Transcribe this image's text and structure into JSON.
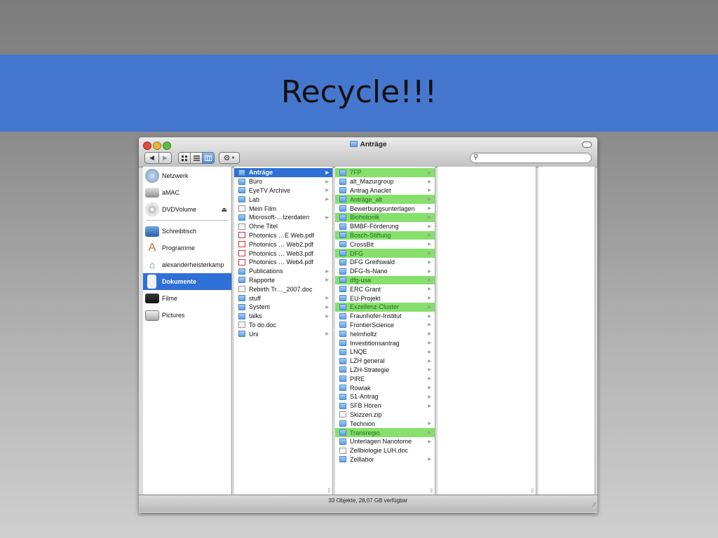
{
  "slide": {
    "title": "Recycle!!!"
  },
  "window": {
    "title": "Anträge",
    "status": "33 Objekte, 28,07 GB verfügbar",
    "toolbar": {
      "back": "◀",
      "forward": "▶",
      "search_placeholder": ""
    }
  },
  "sidebar": {
    "items": [
      {
        "label": "Netzwerk",
        "icon": "network-globe-icon"
      },
      {
        "label": "aMAC",
        "icon": "hard-drive-icon"
      },
      {
        "label": "DVDVolume",
        "icon": "dvd-icon"
      },
      {
        "label": "Schreibtisch",
        "icon": "desktop-icon"
      },
      {
        "label": "Programme",
        "icon": "applications-icon"
      },
      {
        "label": "alexanderheisterkamp",
        "icon": "home-icon"
      },
      {
        "label": "Dokumente",
        "icon": "documents-icon",
        "selected": true
      },
      {
        "label": "Filme",
        "icon": "movies-icon"
      },
      {
        "label": "Pictures",
        "icon": "pictures-icon"
      }
    ]
  },
  "column1": [
    {
      "name": "Anträge",
      "kind": "folder",
      "arrow": true,
      "selected": true
    },
    {
      "name": "Büro",
      "kind": "folder",
      "arrow": true
    },
    {
      "name": "EyeTV Archive",
      "kind": "folder",
      "arrow": true
    },
    {
      "name": "Lab",
      "kind": "folder",
      "arrow": true
    },
    {
      "name": "Mein Film",
      "kind": "doc",
      "arrow": false
    },
    {
      "name": "Microsoft-…tzerdaten",
      "kind": "folder",
      "arrow": true
    },
    {
      "name": "Ohne Titel",
      "kind": "doc",
      "arrow": false
    },
    {
      "name": "Photonics …E Web.pdf",
      "kind": "pdf",
      "arrow": false
    },
    {
      "name": "Photonics … Web2.pdf",
      "kind": "pdf",
      "arrow": false
    },
    {
      "name": "Photonics … Web3.pdf",
      "kind": "pdf",
      "arrow": false
    },
    {
      "name": "Photonics … Web4.pdf",
      "kind": "pdf",
      "arrow": false
    },
    {
      "name": "Publications",
      "kind": "folder",
      "arrow": true
    },
    {
      "name": "Rapporte",
      "kind": "folder",
      "arrow": true
    },
    {
      "name": "Rebirth Tr…_2007.doc",
      "kind": "doc",
      "arrow": false
    },
    {
      "name": "stuff",
      "kind": "folder",
      "arrow": true
    },
    {
      "name": "System",
      "kind": "folder",
      "arrow": true
    },
    {
      "name": "talks",
      "kind": "folder",
      "arrow": true
    },
    {
      "name": "To do.doc",
      "kind": "doc",
      "arrow": false
    },
    {
      "name": "Uni",
      "kind": "folder",
      "arrow": true
    }
  ],
  "column2": [
    {
      "name": "7FP",
      "kind": "folder",
      "arrow": true,
      "highlight": true
    },
    {
      "name": "alt_Mazurgroup",
      "kind": "folder",
      "arrow": true
    },
    {
      "name": "Antrag Anaclet",
      "kind": "folder",
      "arrow": true
    },
    {
      "name": "Anträge_alt",
      "kind": "folder",
      "arrow": true,
      "highlight": true
    },
    {
      "name": "Bewerbungsunterlagen",
      "kind": "folder",
      "arrow": true
    },
    {
      "name": "Biohotonik",
      "kind": "folder",
      "arrow": true,
      "highlight": true
    },
    {
      "name": "BMBF-Förderung",
      "kind": "folder",
      "arrow": true
    },
    {
      "name": "Bosch-Stiftung",
      "kind": "folder",
      "arrow": true,
      "highlight": true
    },
    {
      "name": "CrossBit",
      "kind": "folder",
      "arrow": true
    },
    {
      "name": "DFG",
      "kind": "folder",
      "arrow": true,
      "highlight": true
    },
    {
      "name": "DFG Greifswald",
      "kind": "folder",
      "arrow": true
    },
    {
      "name": "DFG-fs-Nano",
      "kind": "folder",
      "arrow": true
    },
    {
      "name": "dfg-usa",
      "kind": "folder",
      "arrow": true,
      "highlight": true
    },
    {
      "name": "ERC Grant",
      "kind": "folder",
      "arrow": true
    },
    {
      "name": "EU-Projekt",
      "kind": "folder",
      "arrow": true
    },
    {
      "name": "Exzellenz-Cluster",
      "kind": "folder",
      "arrow": true,
      "highlight": true
    },
    {
      "name": "Fraunhofer-Institut",
      "kind": "folder",
      "arrow": true
    },
    {
      "name": "FrontierScience",
      "kind": "folder",
      "arrow": true
    },
    {
      "name": "helmholtz",
      "kind": "folder",
      "arrow": true
    },
    {
      "name": "Investitionsantrag",
      "kind": "folder",
      "arrow": true
    },
    {
      "name": "LNQE",
      "kind": "folder",
      "arrow": true
    },
    {
      "name": "LZH general",
      "kind": "folder",
      "arrow": true
    },
    {
      "name": "LZH-Strategie",
      "kind": "folder",
      "arrow": true
    },
    {
      "name": "PIRE",
      "kind": "folder",
      "arrow": true
    },
    {
      "name": "Rowiak",
      "kind": "folder",
      "arrow": true
    },
    {
      "name": "S1-Antrag",
      "kind": "folder",
      "arrow": true
    },
    {
      "name": "SFB Hören",
      "kind": "folder",
      "arrow": true
    },
    {
      "name": "Skizzen.zip",
      "kind": "doc",
      "arrow": false
    },
    {
      "name": "Technion",
      "kind": "folder",
      "arrow": true
    },
    {
      "name": "Transregio",
      "kind": "folder",
      "arrow": true,
      "highlight": true
    },
    {
      "name": "Unterlagen Nanotome",
      "kind": "folder",
      "arrow": true
    },
    {
      "name": "Zellbiologie LUH.doc",
      "kind": "doc",
      "arrow": false
    },
    {
      "name": "Zelllabor",
      "kind": "folder",
      "arrow": true
    }
  ],
  "colors": {
    "banner": "#4677cf",
    "selection": "#2f70d6",
    "highlight": "#86e06b"
  }
}
